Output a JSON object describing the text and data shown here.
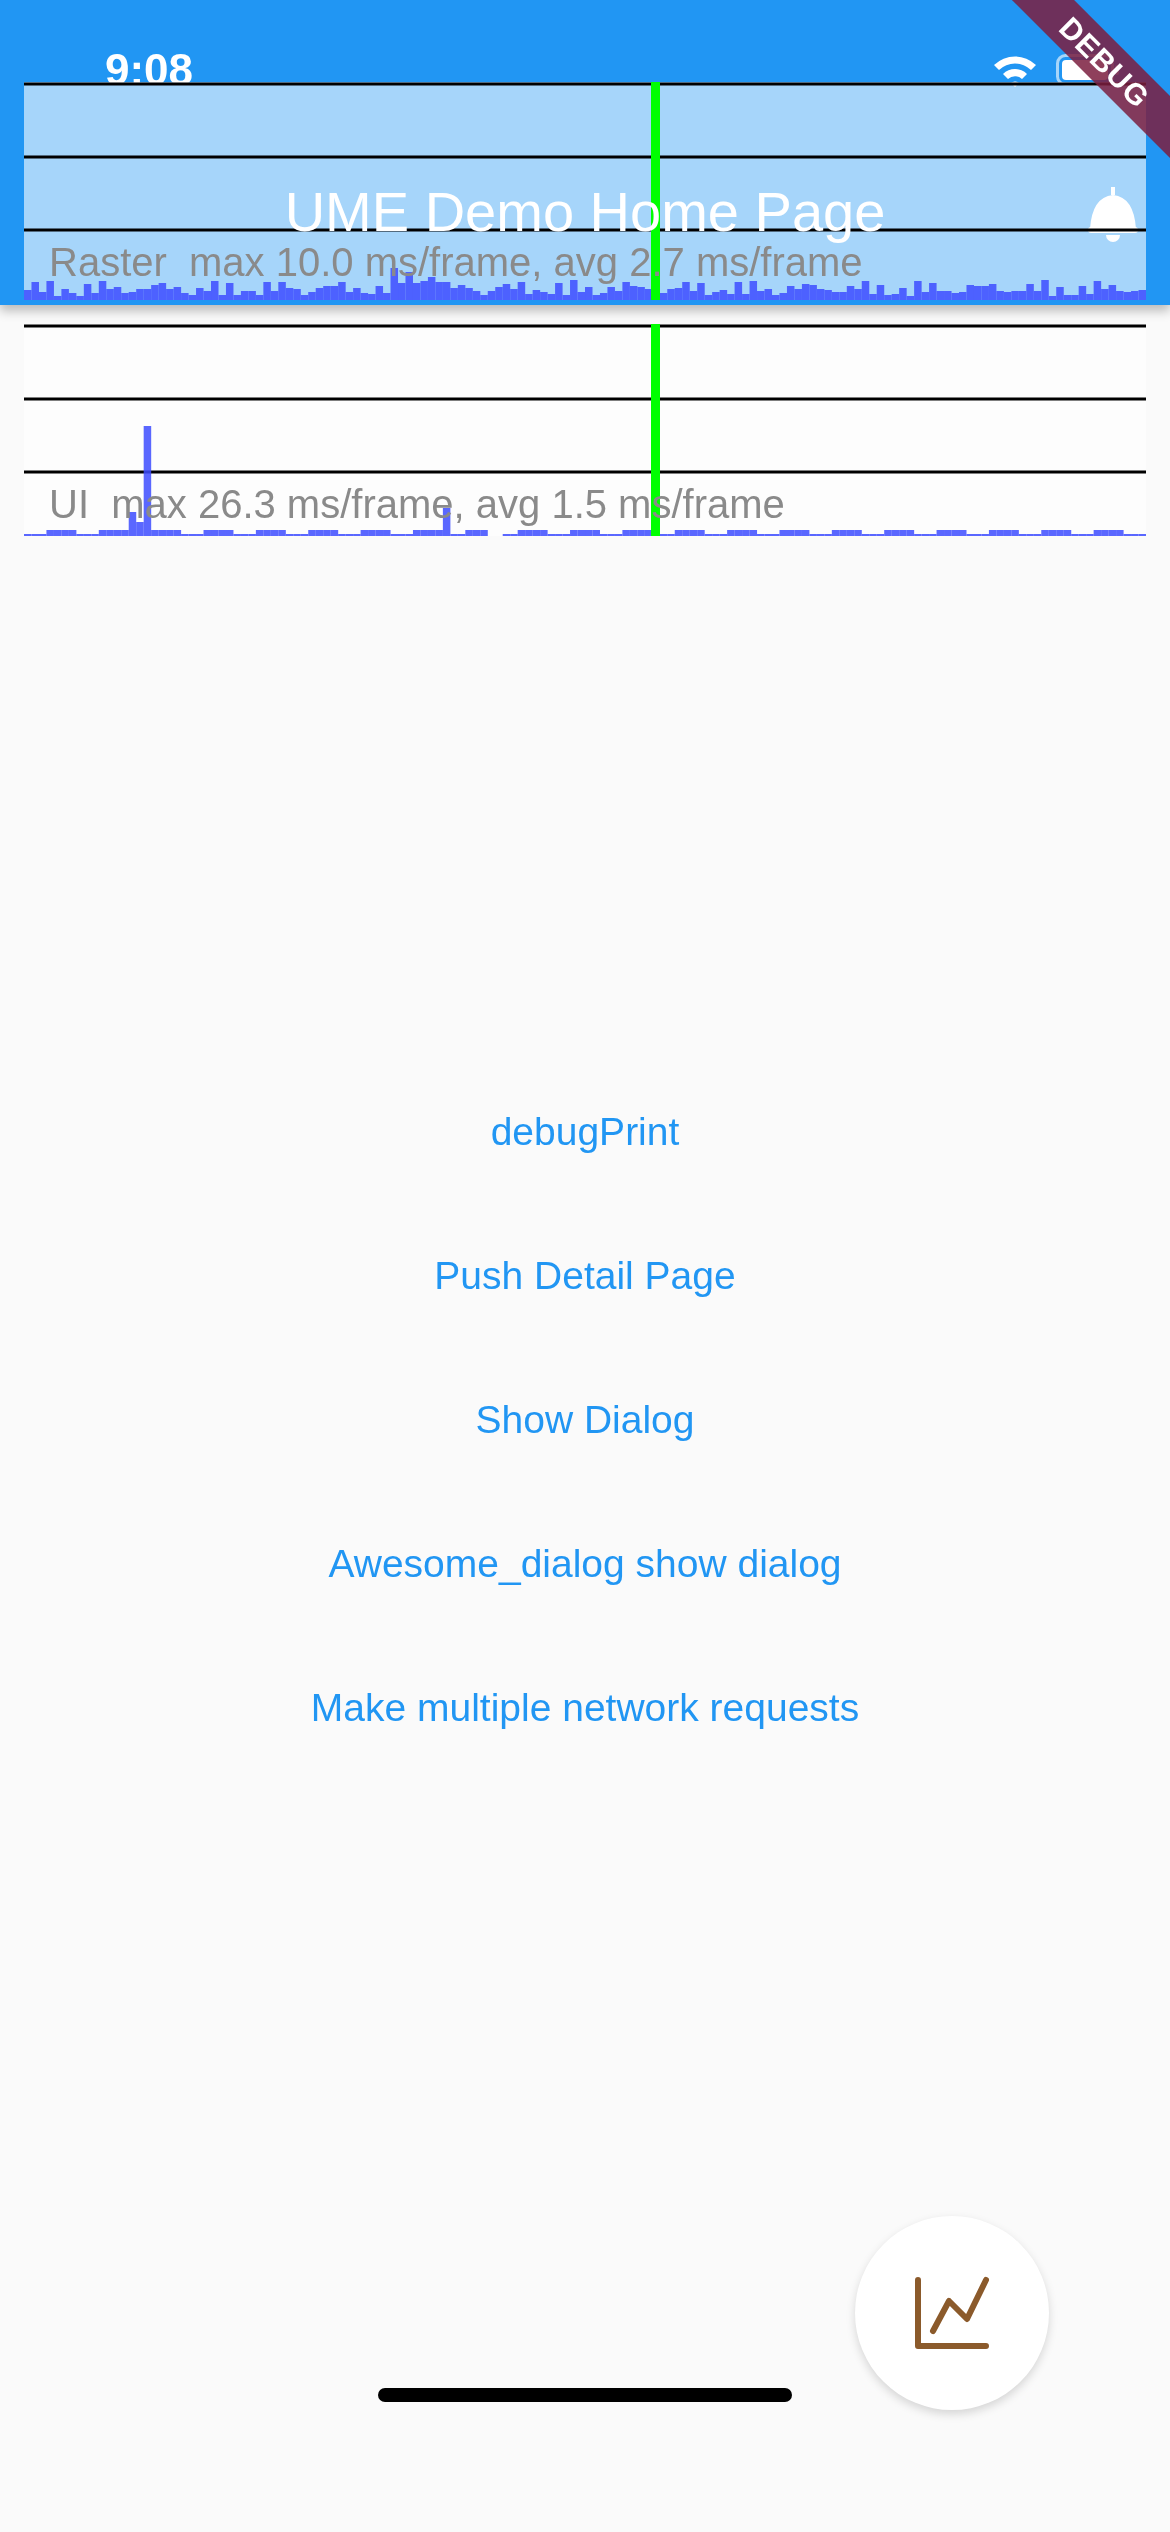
{
  "status_bar": {
    "time": "9:08"
  },
  "debug_banner": "DEBUG",
  "app_bar": {
    "title": "UME Demo Home Page"
  },
  "performance_overlay": [
    {
      "label": "Raster  max 10.0 ms/frame, avg 2.7 ms/frame"
    },
    {
      "label": "UI  max 26.3 ms/frame, avg 1.5 ms/frame"
    }
  ],
  "buttons": [
    "debugPrint",
    "Push Detail Page",
    "Show Dialog",
    "Awesome_dialog show dialog",
    "Make multiple network requests"
  ]
}
